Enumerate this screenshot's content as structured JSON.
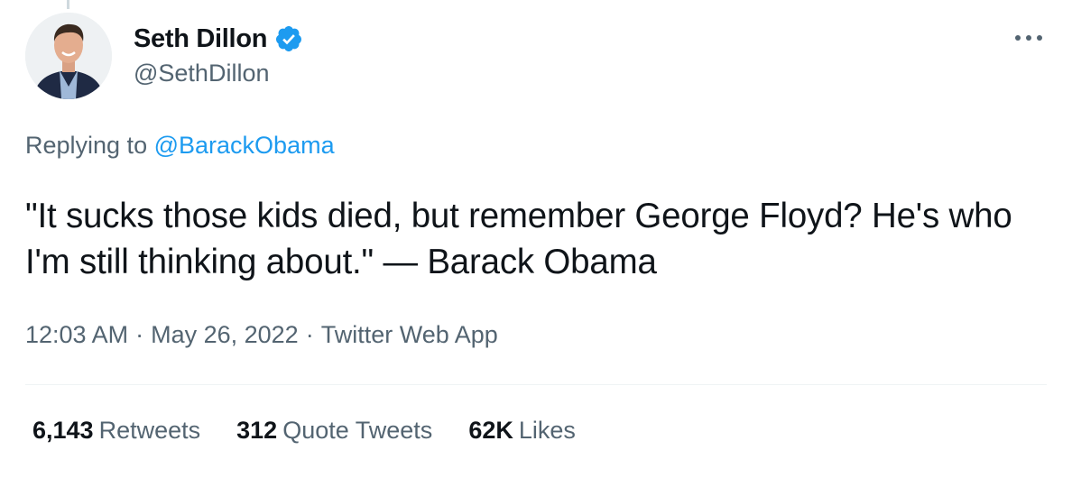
{
  "tweet": {
    "author": {
      "display_name": "Seth Dillon",
      "handle": "@SethDillon",
      "verified": true,
      "avatar_icon": "profile-photo"
    },
    "more_icon": "more-horizontal-icon",
    "replying_prefix": "Replying to",
    "replying_to": "@BarackObama",
    "text": "\"It sucks those kids died, but remember George Floyd? He's who I'm still thinking about.\" — Barack Obama",
    "time": "12:03 AM",
    "separator": "·",
    "date": "May 26, 2022",
    "source": "Twitter Web App",
    "stats": {
      "retweets_count": "6,143",
      "retweets_label": "Retweets",
      "quotes_count": "312",
      "quotes_label": "Quote Tweets",
      "likes_count": "62K",
      "likes_label": "Likes"
    }
  },
  "colors": {
    "primary_text": "#0f1419",
    "secondary_text": "#536471",
    "link": "#1d9bf0",
    "divider": "#eff3f4"
  }
}
